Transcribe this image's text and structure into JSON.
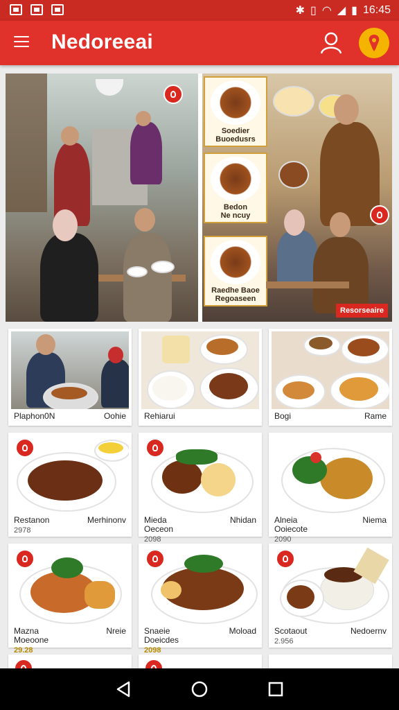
{
  "status_bar": {
    "time": "16:45",
    "icons": [
      "image-icon",
      "flipboard-icon",
      "x-icon"
    ],
    "right_icons": [
      "bluetooth-icon",
      "vibrate-icon",
      "wifi-icon",
      "signal-icon",
      "battery-icon"
    ]
  },
  "app_bar": {
    "title": "Nedoreeai",
    "accent": "#e0322a",
    "badge_color": "#f5b400"
  },
  "hero": {
    "menu_cards": [
      {
        "caption": "Soedier\nBuoedusrs"
      },
      {
        "caption": "Bedon\nNe ncuy"
      },
      {
        "caption": "Raedhe Baoe\nRegoaseen"
      }
    ],
    "tag": "Resorseaire"
  },
  "cards": [
    {
      "left": "Plaphon0N",
      "right": "Oohie",
      "price": ""
    },
    {
      "left": "Rehiarui",
      "right": "",
      "price": ""
    },
    {
      "left": "Bogi",
      "right": "Rame",
      "price": ""
    },
    {
      "left": "Restanon",
      "right": "Merhinonv",
      "price": "2978"
    },
    {
      "left": "Mieda\nOeceon",
      "right": "Nhidan",
      "price": "2098"
    },
    {
      "left": "Alneia\nOoiecote",
      "right": "Niema",
      "price": "2090"
    },
    {
      "left": "Mazna\nMoeoone",
      "right": "Nreie",
      "price": "29.28"
    },
    {
      "left": "Snaeie\nDoeicdes",
      "right": "Moload",
      "price": "2098"
    },
    {
      "left": "Scotaout",
      "right": "Nedoernv",
      "price": "2.956"
    }
  ]
}
